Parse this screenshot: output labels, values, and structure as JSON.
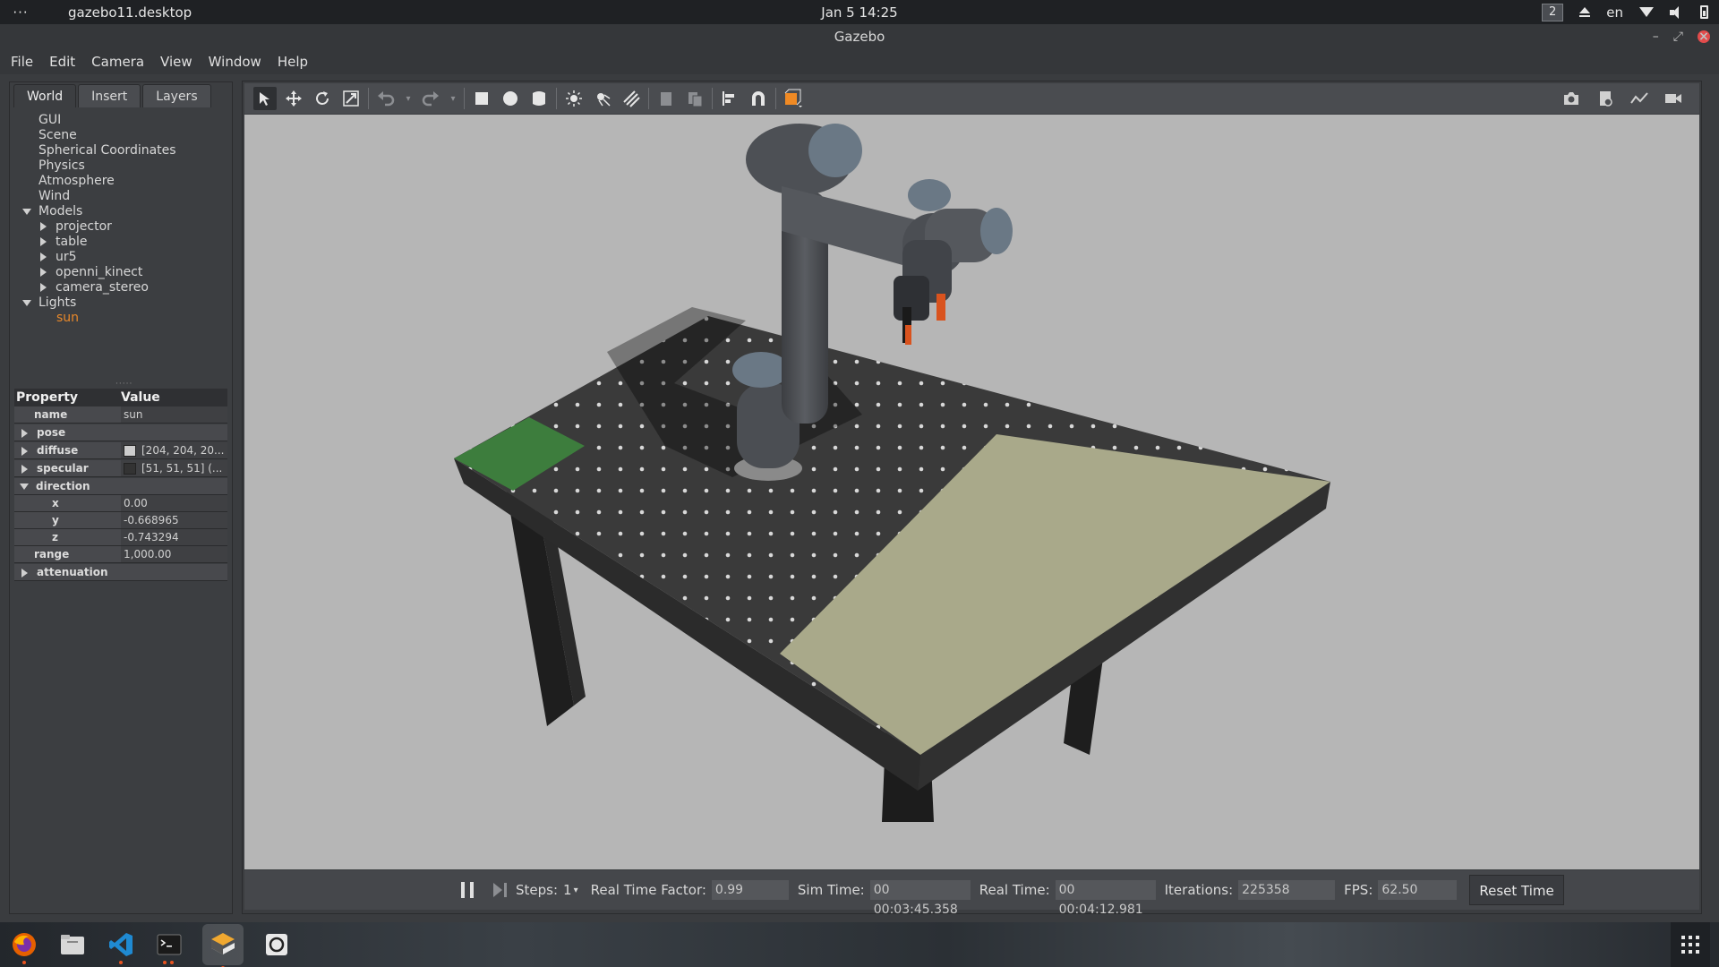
{
  "topbar": {
    "activities": "···",
    "app": "gazebo11.desktop",
    "clock": "Jan 5  14:25",
    "workspace": "2",
    "lang": "en"
  },
  "window": {
    "title": "Gazebo"
  },
  "menu": [
    "File",
    "Edit",
    "Camera",
    "View",
    "Window",
    "Help"
  ],
  "tabs": [
    "World",
    "Insert",
    "Layers"
  ],
  "tree": {
    "gui": "GUI",
    "scene": "Scene",
    "spherical": "Spherical Coordinates",
    "physics": "Physics",
    "atmosphere": "Atmosphere",
    "wind": "Wind",
    "models": "Models",
    "model_items": [
      "projector",
      "table",
      "ur5",
      "openni_kinect",
      "camera_stereo"
    ],
    "lights": "Lights",
    "light_items": [
      "sun"
    ]
  },
  "props": {
    "h_prop": "Property",
    "h_val": "Value",
    "name_k": "name",
    "name_v": "sun",
    "pose": "pose",
    "diffuse_k": "diffuse",
    "diffuse_v": "[204, 204, 20...",
    "specular_k": "specular",
    "specular_v": "[51, 51, 51] (...",
    "direction": "direction",
    "x_k": "x",
    "x_v": "0.00",
    "y_k": "y",
    "y_v": "-0.668965",
    "z_k": "z",
    "z_v": "-0.743294",
    "range_k": "range",
    "range_v": "1,000.00",
    "attenuation": "attenuation"
  },
  "colors": {
    "selected_light": "#e8882a",
    "diffuse_swatch": "#cccccc",
    "specular_swatch": "#333333",
    "viewport_bg": "#b6b6b6"
  },
  "bottom": {
    "steps_label": "Steps:",
    "steps_value": "1",
    "rtf_label": "Real Time Factor:",
    "rtf_value": "0.99",
    "sim_label": "Sim Time:",
    "sim_value": "00 00:03:45.358",
    "real_label": "Real Time:",
    "real_value": "00 00:04:12.981",
    "iter_label": "Iterations:",
    "iter_value": "225358",
    "fps_label": "FPS:",
    "fps_value": "62.50",
    "reset": "Reset Time"
  }
}
